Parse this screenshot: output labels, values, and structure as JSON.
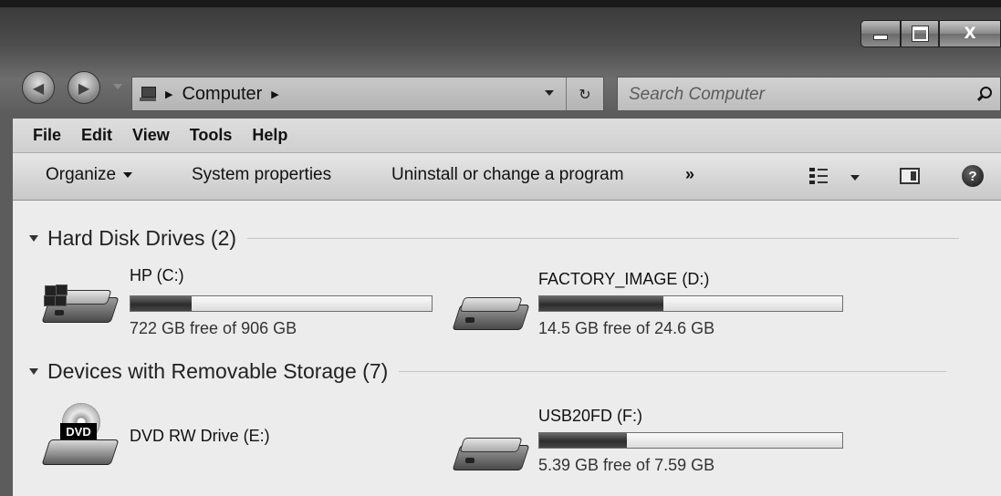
{
  "window": {
    "minimize_label": "",
    "maximize_label": "",
    "close_label": "X"
  },
  "nav": {
    "back_glyph": "◀",
    "forward_glyph": "▶"
  },
  "address": {
    "location_icon": "computer-icon",
    "separator": "▶",
    "crumb": "Computer",
    "refresh_glyph": "↻"
  },
  "search": {
    "placeholder": "Search Computer",
    "icon": "search-icon"
  },
  "menu": [
    "File",
    "Edit",
    "View",
    "Tools",
    "Help"
  ],
  "commands": {
    "organize": "Organize",
    "system_properties": "System properties",
    "uninstall": "Uninstall or change a program",
    "more": "»",
    "help": "?"
  },
  "groups": [
    {
      "title": "Hard Disk Drives (2)",
      "drives": [
        {
          "name": "HP (C:)",
          "free_text": "722 GB free of 906 GB",
          "used_fraction": 0.203,
          "icon": "hard-drive-windows-icon"
        },
        {
          "name": "FACTORY_IMAGE (D:)",
          "free_text": "14.5 GB free of 24.6 GB",
          "used_fraction": 0.41,
          "icon": "hard-drive-icon"
        }
      ]
    },
    {
      "title": "Devices with Removable Storage (7)",
      "drives": [
        {
          "name": "DVD RW Drive (E:)",
          "icon": "dvd-drive-icon",
          "badge": "DVD"
        },
        {
          "name": "USB20FD (F:)",
          "free_text": "5.39 GB free of 7.59 GB",
          "used_fraction": 0.29,
          "icon": "usb-drive-icon"
        }
      ]
    }
  ]
}
